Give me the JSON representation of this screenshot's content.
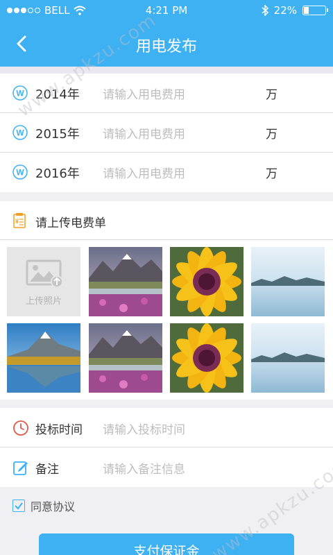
{
  "status_bar": {
    "carrier": "BELL",
    "time": "4:21 PM",
    "battery": "22%",
    "battery_level": 0.22
  },
  "nav": {
    "title": "用电发布"
  },
  "usage_rows": [
    {
      "year": "2014年",
      "placeholder": "请输入用电费用",
      "unit": "万"
    },
    {
      "year": "2015年",
      "placeholder": "请输入用电费用",
      "unit": "万"
    },
    {
      "year": "2016年",
      "placeholder": "请输入用电费用",
      "unit": "万"
    }
  ],
  "upload": {
    "title": "请上传电费单",
    "add_label": "上传照片"
  },
  "bid_time": {
    "label": "投标时间",
    "placeholder": "请输入投标时间"
  },
  "remark": {
    "label": "备注",
    "placeholder": "请输入备注信息"
  },
  "agreement": {
    "label": "同意协议",
    "checked": true
  },
  "pay_button": "支付保证金",
  "watermark": "www.apkzu.com",
  "colors": {
    "primary": "#3db1f2",
    "background": "#efeff4"
  }
}
